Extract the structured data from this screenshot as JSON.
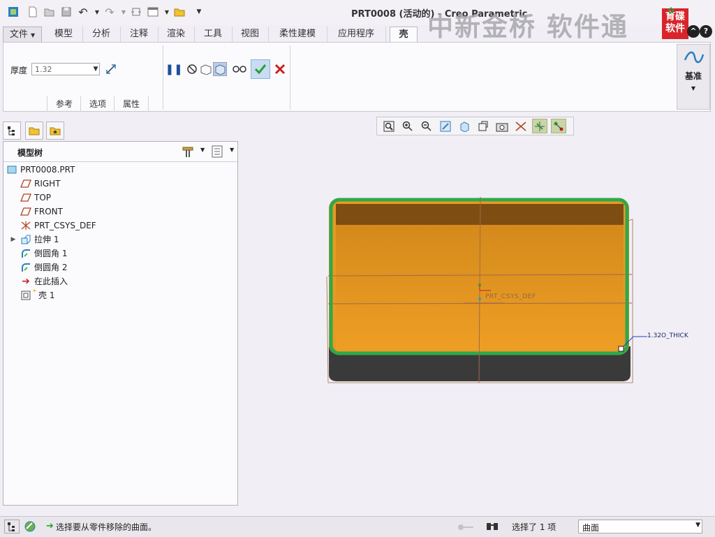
{
  "window": {
    "title": "PRT0008 (活动的) - Creo Parametric",
    "watermark": "中新金桥 软件通",
    "logo_text": "育碟 软件"
  },
  "quick_access": [
    "app-icon",
    "new-icon",
    "open-icon",
    "save-icon",
    "undo-icon",
    "redo-icon",
    "regenerate-icon",
    "windows-icon",
    "close-window-icon",
    "customize-icon"
  ],
  "ribbon": {
    "tabs": [
      "文件",
      "模型",
      "分析",
      "注释",
      "渲染",
      "工具",
      "视图",
      "柔性建模",
      "应用程序",
      "壳"
    ],
    "active_tab": "壳"
  },
  "dashboard": {
    "thickness_label": "厚度",
    "thickness_value": "1.32",
    "subtabs": [
      "参考",
      "选项",
      "属性"
    ],
    "datum_label": "基准",
    "confirm_color": "#2c9f35",
    "cancel_color": "#c8201e"
  },
  "model_tree": {
    "title": "模型树",
    "items": [
      {
        "label": "PRT0008.PRT",
        "icon": "part-icon"
      },
      {
        "label": "RIGHT",
        "icon": "datum-plane-icon"
      },
      {
        "label": "TOP",
        "icon": "datum-plane-icon"
      },
      {
        "label": "FRONT",
        "icon": "datum-plane-icon"
      },
      {
        "label": "PRT_CSYS_DEF",
        "icon": "csys-icon"
      },
      {
        "label": "拉伸 1",
        "icon": "extrude-icon",
        "expandable": true
      },
      {
        "label": "倒圆角 1",
        "icon": "round-icon"
      },
      {
        "label": "倒圆角 2",
        "icon": "round-icon"
      },
      {
        "label": "在此插入",
        "icon": "insert-here-icon"
      },
      {
        "label": "壳 1",
        "icon": "shell-icon"
      }
    ]
  },
  "graphics": {
    "csys_label": "PRT_CSYS_DEF",
    "dimension_label": "1.32O_THICK",
    "body_color": "#e89a22",
    "highlight_color": "#2fa84a"
  },
  "status": {
    "message": "选择要从零件移除的曲面。",
    "selected": "选择了 1 项",
    "filter": "曲面"
  }
}
